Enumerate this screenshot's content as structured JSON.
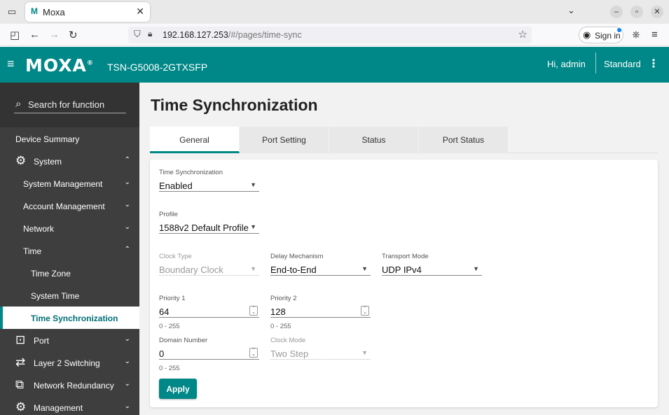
{
  "browser": {
    "tab_title": "Moxa",
    "favicon_text": "M",
    "url_host": "192.168.127.253",
    "url_path": "/#/pages/time-sync",
    "sign_in": "Sign in"
  },
  "app": {
    "logo": "MOXA",
    "logo_mark": "®",
    "model": "TSN-G5008-2GTXSFP",
    "greeting": "Hi, admin",
    "mode": "Standard",
    "accent_color": "#008787"
  },
  "sidebar": {
    "search_placeholder": "Search for function",
    "items": [
      {
        "label": "Device Summary"
      },
      {
        "label": "System",
        "icon": "gear-icon"
      },
      {
        "label": "System Management"
      },
      {
        "label": "Account Management"
      },
      {
        "label": "Network"
      },
      {
        "label": "Time"
      },
      {
        "label": "Time Zone"
      },
      {
        "label": "System Time"
      },
      {
        "label": "Time Synchronization"
      },
      {
        "label": "Port",
        "icon": "port-icon"
      },
      {
        "label": "Layer 2 Switching",
        "icon": "switching-icon"
      },
      {
        "label": "Network Redundancy",
        "icon": "redundancy-icon"
      },
      {
        "label": "Management",
        "icon": "management-icon"
      }
    ]
  },
  "page": {
    "title": "Time Synchronization",
    "tabs": [
      {
        "label": "General",
        "active": true
      },
      {
        "label": "Port Setting"
      },
      {
        "label": "Status"
      },
      {
        "label": "Port Status"
      }
    ]
  },
  "form": {
    "time_sync": {
      "label": "Time Synchronization",
      "value": "Enabled"
    },
    "profile": {
      "label": "Profile",
      "value": "1588v2 Default Profile"
    },
    "clock_type": {
      "label": "Clock Type",
      "value": "Boundary Clock"
    },
    "delay_mechanism": {
      "label": "Delay Mechanism",
      "value": "End-to-End"
    },
    "transport_mode": {
      "label": "Transport Mode",
      "value": "UDP IPv4"
    },
    "priority1": {
      "label": "Priority 1",
      "value": "64",
      "hint": "0 - 255"
    },
    "priority2": {
      "label": "Priority 2",
      "value": "128",
      "hint": "0 - 255"
    },
    "domain_number": {
      "label": "Domain Number",
      "value": "0",
      "hint": "0 - 255"
    },
    "clock_mode": {
      "label": "Clock Mode",
      "value": "Two Step"
    },
    "apply_label": "Apply"
  }
}
